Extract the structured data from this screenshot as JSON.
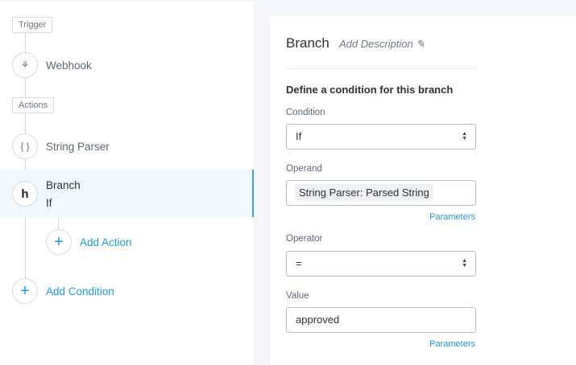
{
  "sidebar": {
    "trigger_tag": "Trigger",
    "webhook": "Webhook",
    "actions_tag": "Actions",
    "string_parser": "String Parser",
    "branch": "Branch",
    "branch_sub": "If",
    "add_action": "Add Action",
    "add_condition": "Add Condition"
  },
  "panel": {
    "title": "Branch",
    "add_description": "Add Description",
    "section_title": "Define a condition for this branch",
    "condition_label": "Condition",
    "condition_value": "If",
    "operand_label": "Operand",
    "operand_chip": "String Parser: Parsed String",
    "parameters": "Parameters",
    "operator_label": "Operator",
    "operator_value": "=",
    "value_label": "Value",
    "value_value": "approved"
  },
  "colors": {
    "accent": "#1a9be0",
    "selected_bg": "#f1f8fd"
  }
}
